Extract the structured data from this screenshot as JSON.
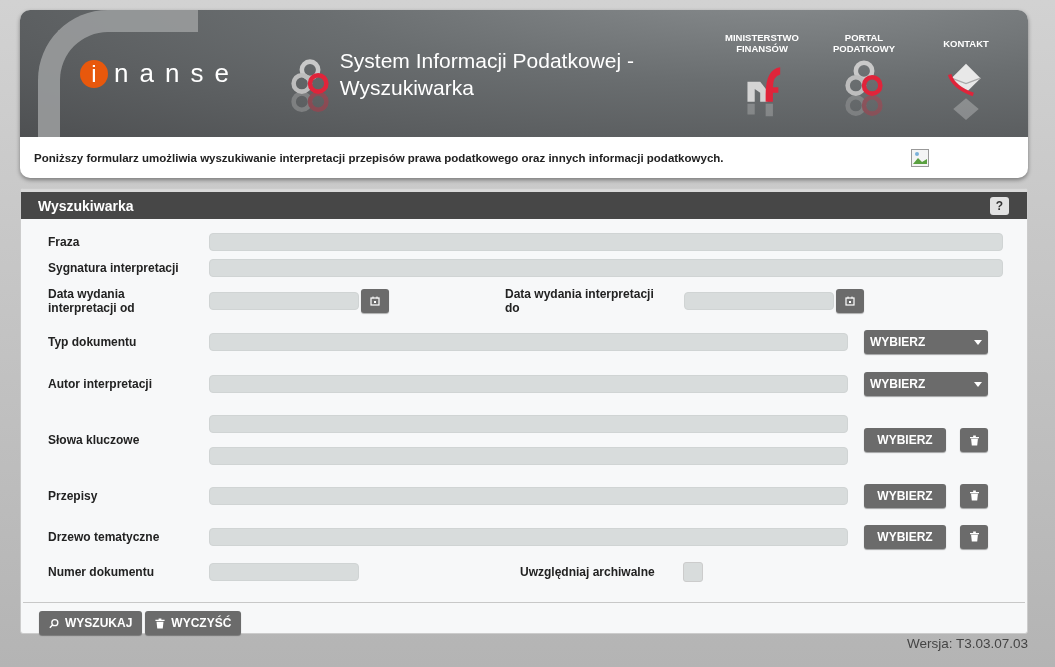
{
  "header": {
    "logo": {
      "letter": "i",
      "rest": "nanse"
    },
    "title": "System Informacji Podatkowej - Wyszukiwarka",
    "links": [
      {
        "label": "MINISTERSTWO\nFINANSÓW",
        "kind": "ministry"
      },
      {
        "label": "PORTAL\nPODATKOWY",
        "kind": "portal"
      },
      {
        "label": "KONTAKT",
        "kind": "contact"
      }
    ],
    "description": "Poniższy formularz umożliwia wyszukiwanie interpretacji przepisów prawa podatkowego oraz innych informacji podatkowych."
  },
  "panel": {
    "title": "Wyszukiwarka",
    "help": "?",
    "fields": [
      {
        "kind": "text",
        "label": "Fraza"
      },
      {
        "kind": "text",
        "label": "Sygnatura interpretacji"
      },
      {
        "kind": "date-range",
        "label": "Data wydania interpretacji od",
        "label_to": "Data wydania interpretacji do"
      },
      {
        "kind": "select",
        "label": "Typ dokumentu",
        "button": "WYBIERZ"
      },
      {
        "kind": "select",
        "label": "Autor interpretacji",
        "button": "WYBIERZ"
      },
      {
        "kind": "keywords",
        "label": "Słowa kluczowe",
        "button": "WYBIERZ"
      },
      {
        "kind": "picker",
        "label": "Przepisy",
        "button": "WYBIERZ"
      },
      {
        "kind": "picker",
        "label": "Drzewo tematyczne",
        "button": "WYBIERZ"
      },
      {
        "kind": "number-archive",
        "label": "Numer dokumentu",
        "label_to": "Uwzględniaj archiwalne",
        "checked": false
      }
    ],
    "actions": [
      {
        "kind": "search",
        "label": "WYSZUKAJ"
      },
      {
        "kind": "clear",
        "label": "WYCZYŚĆ"
      }
    ]
  },
  "version": "Wersja: T3.03.07.03"
}
